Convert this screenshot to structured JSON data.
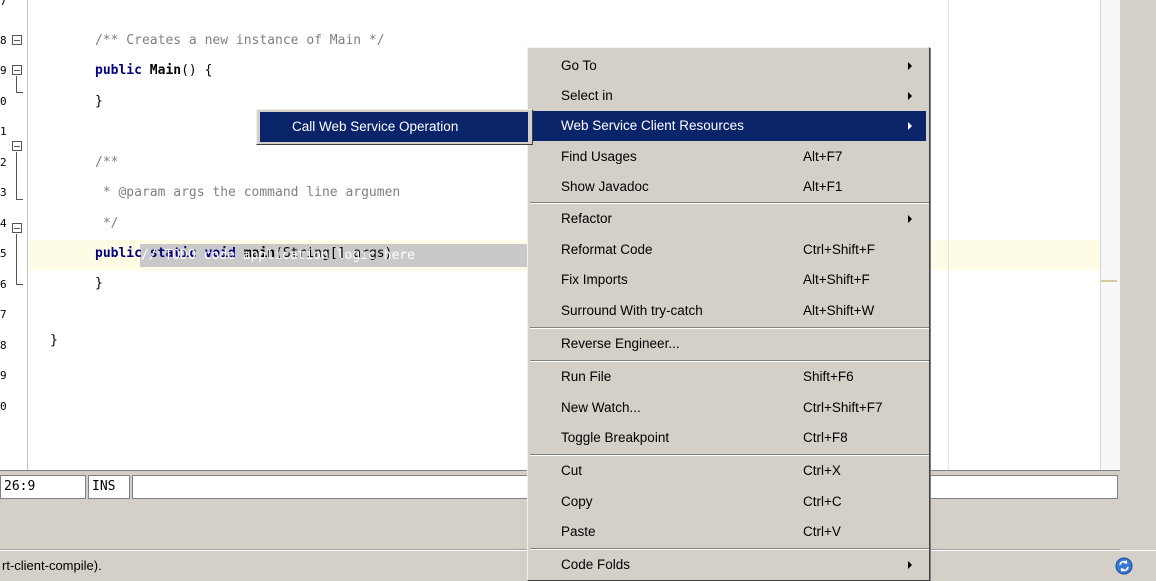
{
  "editor": {
    "line_numbers": [
      "7",
      "8",
      "9",
      "0",
      "1",
      "2",
      "3",
      "4",
      "5",
      "6",
      "7",
      "8",
      "9",
      "0"
    ],
    "lines": {
      "l8": "/** Creates a new instance of Main */",
      "l9_kw": "public",
      "l9_name": "Main",
      "l9_rest": "() {",
      "l10": "}",
      "l12": "/**",
      "l13": " * @param args the command line argumen",
      "l14": " */",
      "l15_kw": "public static void",
      "l15_name": "main",
      "l15_rest": "(String[] args)",
      "l16": "// TODO code application logic here",
      "l17": "}",
      "l19": "}"
    }
  },
  "status": {
    "position": "26:9",
    "mode": "INS",
    "output_text": "rt-client-compile)."
  },
  "context_menu": {
    "items": [
      {
        "label": "Go To",
        "shortcut": "",
        "submenu": true
      },
      {
        "label": "Select in",
        "shortcut": "",
        "submenu": true
      },
      {
        "label": "Web Service Client Resources",
        "shortcut": "",
        "submenu": true,
        "active": true
      },
      {
        "label": "Find Usages",
        "shortcut": "Alt+F7"
      },
      {
        "label": "Show Javadoc",
        "shortcut": "Alt+F1"
      },
      {
        "label": "Refactor",
        "shortcut": "",
        "submenu": true
      },
      {
        "label": "Reformat Code",
        "shortcut": "Ctrl+Shift+F"
      },
      {
        "label": "Fix Imports",
        "shortcut": "Alt+Shift+F"
      },
      {
        "label": "Surround With try-catch",
        "shortcut": "Alt+Shift+W"
      },
      {
        "label": "Reverse Engineer...",
        "shortcut": ""
      },
      {
        "label": "Run File",
        "shortcut": "Shift+F6"
      },
      {
        "label": "New Watch...",
        "shortcut": "Ctrl+Shift+F7"
      },
      {
        "label": "Toggle Breakpoint",
        "shortcut": "Ctrl+F8"
      },
      {
        "label": "Cut",
        "shortcut": "Ctrl+X"
      },
      {
        "label": "Copy",
        "shortcut": "Ctrl+C"
      },
      {
        "label": "Paste",
        "shortcut": "Ctrl+V"
      },
      {
        "label": "Code Folds",
        "shortcut": "",
        "submenu": true
      }
    ]
  },
  "submenu": {
    "items": [
      {
        "label": "Call Web Service Operation",
        "active": true
      }
    ]
  },
  "colors": {
    "menu_highlight": "#0a246a",
    "menu_background": "#d4d0c8",
    "keyword": "#000080",
    "comment": "#808080",
    "current_line": "#fefce4"
  },
  "icons": {
    "status_sync": "sync-icon",
    "submenu_arrow": "submenu-arrow-icon",
    "fold_toggle": "fold-toggle-icon"
  }
}
